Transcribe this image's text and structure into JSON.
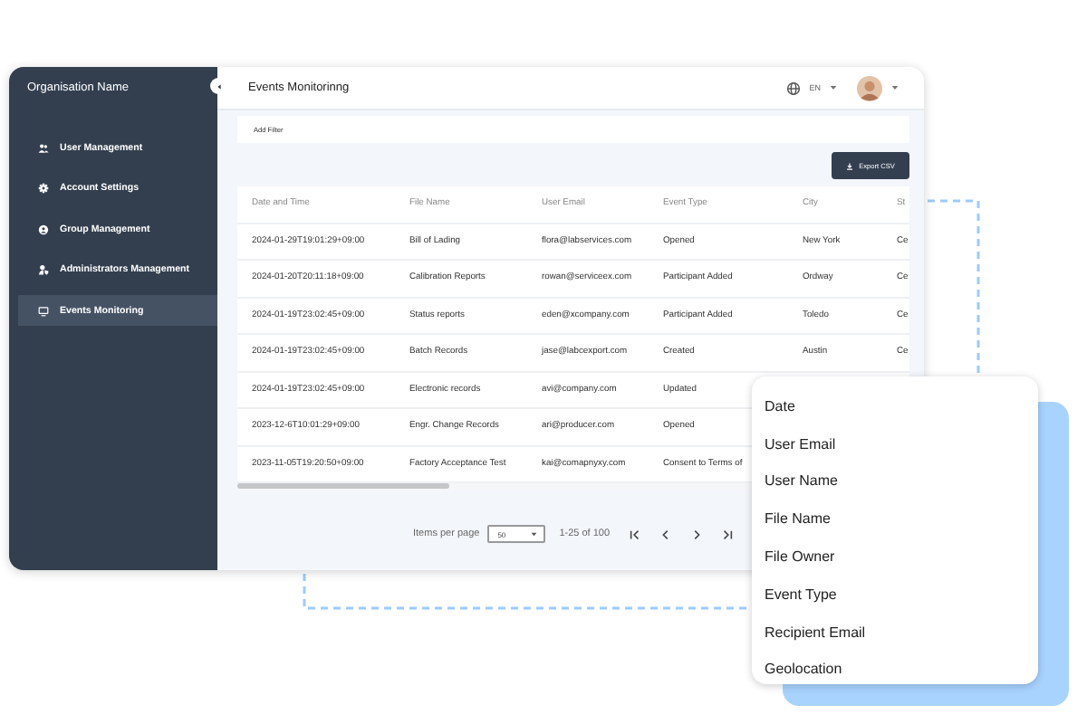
{
  "sidebar": {
    "title": "Organisation Name",
    "items": [
      {
        "label": "User Management",
        "kind": "users",
        "selected": false
      },
      {
        "label": "Account Settings",
        "kind": "gear",
        "selected": false
      },
      {
        "label": "Group Management",
        "kind": "group",
        "selected": false
      },
      {
        "label": "Administrators Management",
        "kind": "admin",
        "selected": false
      },
      {
        "label": "Events Monitoring",
        "kind": "monitor",
        "selected": true
      }
    ]
  },
  "header": {
    "title": "Events Monitorinng",
    "language": "EN"
  },
  "filter": {
    "label": "Add Filter"
  },
  "export_button": "Export CSV",
  "table": {
    "columns": [
      "Date and Time",
      "File Name",
      "User Email",
      "Event Type",
      "City",
      "St"
    ],
    "rows": [
      [
        "2024-01-29T19:01:29+09:00",
        "Bill of Lading",
        "flora@labservices.com",
        "Opened",
        "New York",
        "Ce"
      ],
      [
        "2024-01-20T20:11:18+09:00",
        "Calibration Reports",
        "rowan@serviceex.com",
        "Participant Added",
        "Ordway",
        "Ce"
      ],
      [
        "2024-01-19T23:02:45+09:00",
        "Status reports",
        "eden@xcompany.com",
        "Participant Added",
        "Toledo",
        "Ce"
      ],
      [
        "2024-01-19T23:02:45+09:00",
        "Batch Records",
        "jase@labcexport.com",
        "Created",
        "Austin",
        "Ce"
      ],
      [
        "2024-01-19T23:02:45+09:00",
        "Electronic records",
        "avi@company.com",
        "Updated"
      ],
      [
        "2023-12-6T10:01:29+09:00",
        "Engr. Change Records",
        "ari@producer.com",
        "Opened"
      ],
      [
        "2023-11-05T19:20:50+09:00",
        "Factory Acceptance Test",
        "kai@comapnyxy.com",
        "Consent to Terms of"
      ]
    ]
  },
  "pagination": {
    "items_per_page_label": "Items per page",
    "per_page": "50",
    "range": "1-25 of 100"
  },
  "column_menu": {
    "items": [
      "Date",
      "User Email",
      "User Name",
      "File Name",
      "File Owner",
      "Event Type",
      "Recipient Email",
      "Geolocation"
    ]
  }
}
